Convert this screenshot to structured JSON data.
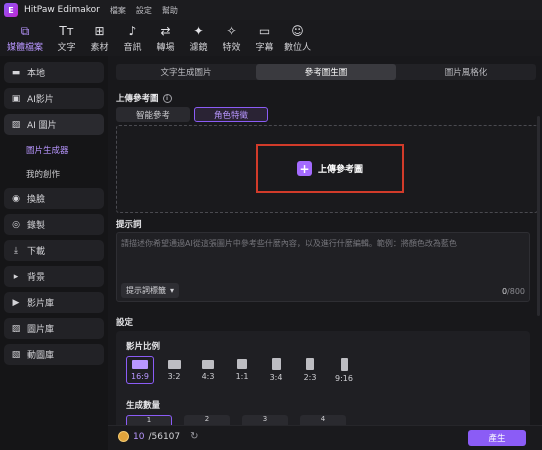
{
  "app": {
    "title": "HitPaw Edimakor",
    "logo_letter": "E"
  },
  "menu": [
    "檔案",
    "設定",
    "幫助"
  ],
  "toolbar": [
    {
      "label": "媒體檔案",
      "icon": "media-files-icon",
      "glyph": "⧉",
      "active": true
    },
    {
      "label": "文字",
      "icon": "text-icon",
      "glyph": "Tт",
      "active": false
    },
    {
      "label": "素材",
      "icon": "assets-icon",
      "glyph": "⊞",
      "active": false
    },
    {
      "label": "音訊",
      "icon": "audio-icon",
      "glyph": "♪",
      "active": false
    },
    {
      "label": "轉場",
      "icon": "transition-icon",
      "glyph": "⇄",
      "active": false
    },
    {
      "label": "濾鏡",
      "icon": "filter-icon",
      "glyph": "✦",
      "active": false
    },
    {
      "label": "特效",
      "icon": "effects-icon",
      "glyph": "✧",
      "active": false
    },
    {
      "label": "字幕",
      "icon": "subtitle-icon",
      "glyph": "▭",
      "active": false
    },
    {
      "label": "數位人",
      "icon": "digital-human-icon",
      "glyph": "☺",
      "active": false
    }
  ],
  "sidebar": {
    "items": [
      {
        "label": "本地",
        "icon": "folder-icon",
        "glyph": "▬"
      },
      {
        "label": "AI影片",
        "icon": "ai-video-icon",
        "glyph": "▣"
      },
      {
        "label": "AI 圖片",
        "icon": "ai-image-icon",
        "glyph": "▨",
        "active": true
      },
      {
        "label": "換臉",
        "icon": "face-swap-icon",
        "glyph": "◉"
      },
      {
        "label": "錄製",
        "icon": "record-icon",
        "glyph": "◎"
      },
      {
        "label": "下載",
        "icon": "download-icon",
        "glyph": "⤓"
      },
      {
        "label": "背景",
        "icon": "background-icon",
        "glyph": "▸"
      },
      {
        "label": "影片庫",
        "icon": "video-library-icon",
        "glyph": "▶"
      },
      {
        "label": "圖片庫",
        "icon": "image-library-icon",
        "glyph": "▨"
      },
      {
        "label": "動圖庫",
        "icon": "gif-library-icon",
        "glyph": "▧"
      }
    ],
    "sub_items": [
      {
        "label": "圖片生成器",
        "active": true
      },
      {
        "label": "我的創作",
        "active": false
      }
    ]
  },
  "tabs": [
    {
      "label": "文字生成圖片",
      "active": false
    },
    {
      "label": "參考圖生圖",
      "active": true
    },
    {
      "label": "圖片風格化",
      "active": false
    }
  ],
  "upload": {
    "section_title": "上傳參考圖",
    "info_glyph": "i",
    "subtabs": [
      {
        "label": "智能參考",
        "active": false
      },
      {
        "label": "角色特徵",
        "active": true
      }
    ],
    "button_label": "上傳參考圖",
    "plus_glyph": "+"
  },
  "prompt": {
    "section_title": "提示詞",
    "placeholder": "請描述你希望通過AI從這張圖片中參考些什麼內容，以及進行什麼編輯。範例：將顏色改為藍色",
    "tag_button_label": "提示詞標籤",
    "tag_chevron": "▾",
    "count_current": "0",
    "count_max": "/800"
  },
  "settings": {
    "section_title": "設定",
    "ratio_label": "影片比例",
    "ratios": [
      {
        "label": "16:9",
        "active": true,
        "w": 16,
        "h": 9
      },
      {
        "label": "3:2",
        "active": false,
        "w": 13,
        "h": 9
      },
      {
        "label": "4:3",
        "active": false,
        "w": 12,
        "h": 9
      },
      {
        "label": "1:1",
        "active": false,
        "w": 10,
        "h": 10
      },
      {
        "label": "3:4",
        "active": false,
        "w": 9,
        "h": 12
      },
      {
        "label": "2:3",
        "active": false,
        "w": 8,
        "h": 12
      },
      {
        "label": "9:16",
        "active": false,
        "w": 7,
        "h": 13
      }
    ],
    "count_label": "生成數量",
    "counts": [
      {
        "label": "1",
        "active": true
      },
      {
        "label": "2",
        "active": false
      },
      {
        "label": "3",
        "active": false
      },
      {
        "label": "4",
        "active": false
      }
    ]
  },
  "footer": {
    "credits_current": "10",
    "credits_total": "/56107",
    "refresh_glyph": "↻",
    "generate_label": "產生"
  },
  "colors": {
    "accent": "#8b5cf6",
    "accent_text": "#b896ff",
    "highlight_border": "#d23b2a"
  }
}
